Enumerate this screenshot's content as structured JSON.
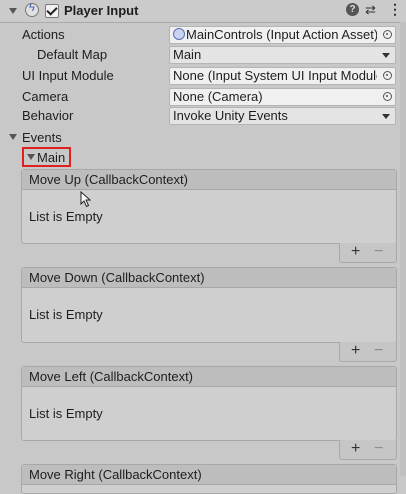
{
  "component": {
    "title": "Player Input",
    "enabled": true
  },
  "properties": {
    "actions": {
      "label": "Actions",
      "value": "MainControls (Input Action Asset)"
    },
    "default_map": {
      "label": "Default Map",
      "value": "Main"
    },
    "ui_input_module": {
      "label": "UI Input Module",
      "value": "None (Input System UI Input Module)"
    },
    "camera": {
      "label": "Camera",
      "value": "None (Camera)"
    },
    "behavior": {
      "label": "Behavior",
      "value": "Invoke Unity Events"
    }
  },
  "events": {
    "label": "Events",
    "group": "Main",
    "panels": [
      {
        "title": "Move Up (CallbackContext)",
        "empty_text": "List is Empty"
      },
      {
        "title": "Move Down (CallbackContext)",
        "empty_text": "List is Empty"
      },
      {
        "title": "Move Left (CallbackContext)",
        "empty_text": "List is Empty"
      },
      {
        "title": "Move Right (CallbackContext)"
      }
    ],
    "add_label": "+",
    "remove_label": "−"
  },
  "icons": {
    "header": [
      "foldout-arrow-icon",
      "lightning-script-icon",
      "enable-checkbox",
      "help-icon",
      "presets-icon",
      "more-options-icon"
    ]
  },
  "colors": {
    "highlight_border": "#e02020",
    "background": "#c8c8c8"
  }
}
